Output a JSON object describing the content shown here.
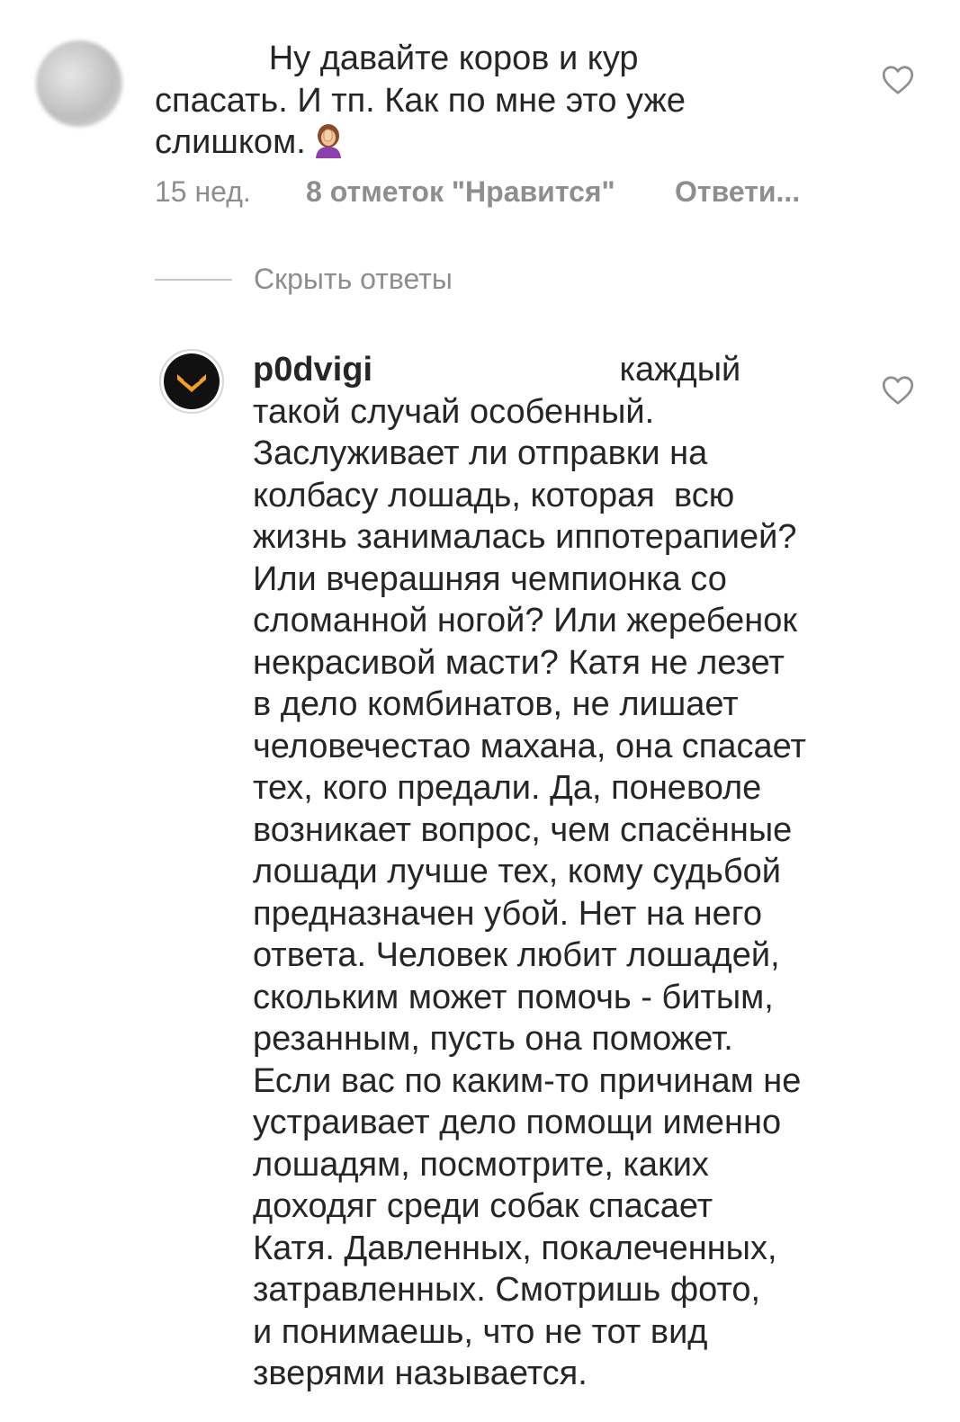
{
  "comments": [
    {
      "text_before_emoji": "            Ну давайте коров и кур\nспасать. И тп. Как по мне это уже\nслишком.",
      "emoji_icon": "woman-facepalming-emoji",
      "time": "15 нед.",
      "likes": "8 отметок \"Нравится\"",
      "reply": "Ответи..."
    },
    {
      "username": "p0dvigi",
      "text": "                          каждый\nтакой случай особенный.\nЗаслуживает ли отправки на\nколбасу лошадь, которая  всю\nжизнь занималась иппотерапией?\nИли вчерашняя чемпионка со\nсломанной ногой? Или жеребенок\nнекрасивой масти? Катя не лезет\nв дело комбинатов, не лишает\nчеловечестао махана, она спасает\nтех, кого предали. Да, поневоле\nвозникает вопрос, чем спасённые\nлошади лучше тех, кому судьбой\nпредназначен убой. Нет на него\nответа. Человек любит лошадей,\nскольким может помочь - битым,\nрезанным, пусть она поможет.\nЕсли вас по каким-то причинам не\nустраивает дело помощи именно\nлошадям, посмотрите, каких\nдоходяг среди собак спасает\nКатя. Давленных, покалеченных,\nзатравленных. Смотришь фото,\nи понимаешь, что не тот вид\nзверями называется."
    }
  ],
  "hide_replies_label": "Скрыть ответы",
  "colors": {
    "text": "#262626",
    "secondary": "#8e8e8e",
    "divider": "#c7c7c7",
    "avatar_logo_bg": "#111111",
    "avatar_logo_accent": "#f0a02a"
  }
}
